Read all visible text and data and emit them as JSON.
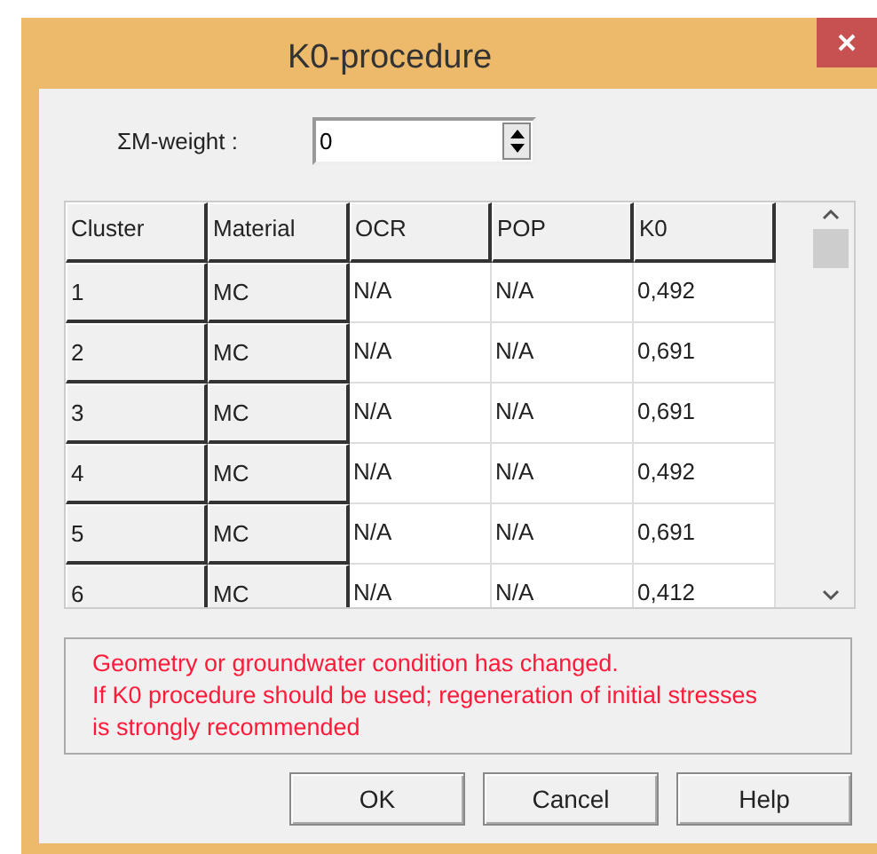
{
  "window": {
    "title": "K0-procedure"
  },
  "weight": {
    "label": "ΣM-weight :",
    "value": "0"
  },
  "table": {
    "columns": [
      "Cluster",
      "Material",
      "OCR",
      "POP",
      "K0"
    ],
    "rows": [
      [
        "1",
        "MC",
        "N/A",
        "N/A",
        "0,492"
      ],
      [
        "2",
        "MC",
        "N/A",
        "N/A",
        "0,691"
      ],
      [
        "3",
        "MC",
        "N/A",
        "N/A",
        "0,691"
      ],
      [
        "4",
        "MC",
        "N/A",
        "N/A",
        "0,492"
      ],
      [
        "5",
        "MC",
        "N/A",
        "N/A",
        "0,691"
      ],
      [
        "6",
        "MC",
        "N/A",
        "N/A",
        "0,412"
      ]
    ]
  },
  "message": [
    "Geometry or groundwater condition has changed.",
    "If K0 procedure should be used; regeneration of initial stresses",
    "is strongly recommended"
  ],
  "buttons": [
    "OK",
    "Cancel",
    "Help"
  ]
}
